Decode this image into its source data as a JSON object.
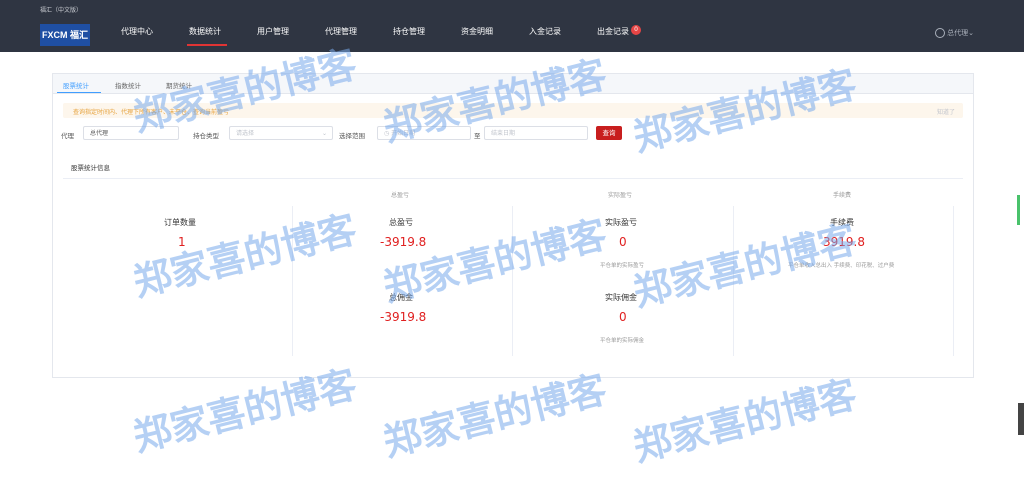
{
  "header": {
    "app_name": "福汇（中文版）",
    "logo_text": "FXCM 福汇",
    "nav": [
      "代理中心",
      "数据统计",
      "用户管理",
      "代理管理",
      "持仓管理",
      "资金明细",
      "入金记录",
      "出金记录"
    ],
    "active_nav": "数据统计",
    "withdraw_badge": "0",
    "user": "总代理"
  },
  "tabs": [
    "股票统计",
    "指数统计",
    "期货统计"
  ],
  "alert": {
    "text": "查询指定时间内、代理下所有客户、未平仓、查询当前盈亏",
    "close": "知道了"
  },
  "filters": {
    "agent_label": "代理",
    "agent_value": "总代理",
    "position_type_label": "持仓类型",
    "position_type_placeholder": "请选择",
    "range_label": "选择范围",
    "start_placeholder": "开始日期",
    "to_label": "至",
    "end_placeholder": "结束日期",
    "query_button": "查询"
  },
  "section_title": "股票统计信息",
  "column_headers": [
    "总盈亏",
    "实际盈亏",
    "手续费"
  ],
  "stats": {
    "order_count": {
      "label": "订单数量",
      "value": "1"
    },
    "total_pnl": {
      "label": "总盈亏",
      "value": "-3919.8"
    },
    "actual_pnl": {
      "label": "实际盈亏",
      "value": "0",
      "note": "平仓单的实际盈亏"
    },
    "fee": {
      "label": "手续费",
      "value": "3919.8",
      "note": "平仓单收入总出入 手续费、印花税、过户费"
    },
    "total_commission": {
      "label": "总佣金",
      "value": "-3919.8"
    },
    "actual_commission": {
      "label": "实际佣金",
      "value": "0",
      "note": "平仓单的实际佣金"
    }
  },
  "watermark": "郑家喜的博客",
  "colors": {
    "header_bg": "#2f3542",
    "accent_red": "#e02020",
    "tab_blue": "#409eff"
  }
}
